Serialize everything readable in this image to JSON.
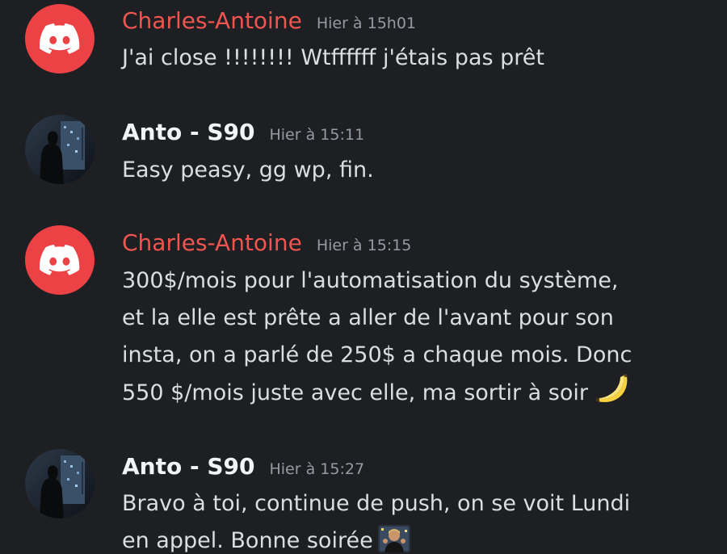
{
  "messages": [
    {
      "author": "Charles-Antoine",
      "author_color": "#f0564f",
      "avatar_icon": "discord-logo-icon",
      "timestamp": "Hier à 15h01",
      "text": "J'ai close !!!!!!!! Wtffffff j'étais pas prêt"
    },
    {
      "author": "Anto - S90",
      "author_color": "#f2f3f5",
      "avatar_icon": "user-photo-avatar",
      "timestamp": "Hier à 15:11",
      "text": "Easy peasy, gg wp, fin."
    },
    {
      "author": "Charles-Antoine",
      "author_color": "#f0564f",
      "avatar_icon": "discord-logo-icon",
      "timestamp": "Hier à 15:15",
      "lines": [
        "300$/mois pour l'automatisation du système,",
        "et la elle est prête a aller de l'avant pour son",
        "insta, on a parlé de 250$ a chaque mois. Donc",
        "550 $/mois juste avec elle, ma sortir à soir"
      ],
      "emoji": "banana-emoji"
    },
    {
      "author": "Anto - S90",
      "author_color": "#f2f3f5",
      "avatar_icon": "user-photo-avatar",
      "timestamp": "Hier à 15:27",
      "lines": [
        "Bravo à toi, continue de push, on se voit Lundi",
        "en appel. Bonne soirée"
      ],
      "emoji": "clapping-man-emoji"
    }
  ]
}
